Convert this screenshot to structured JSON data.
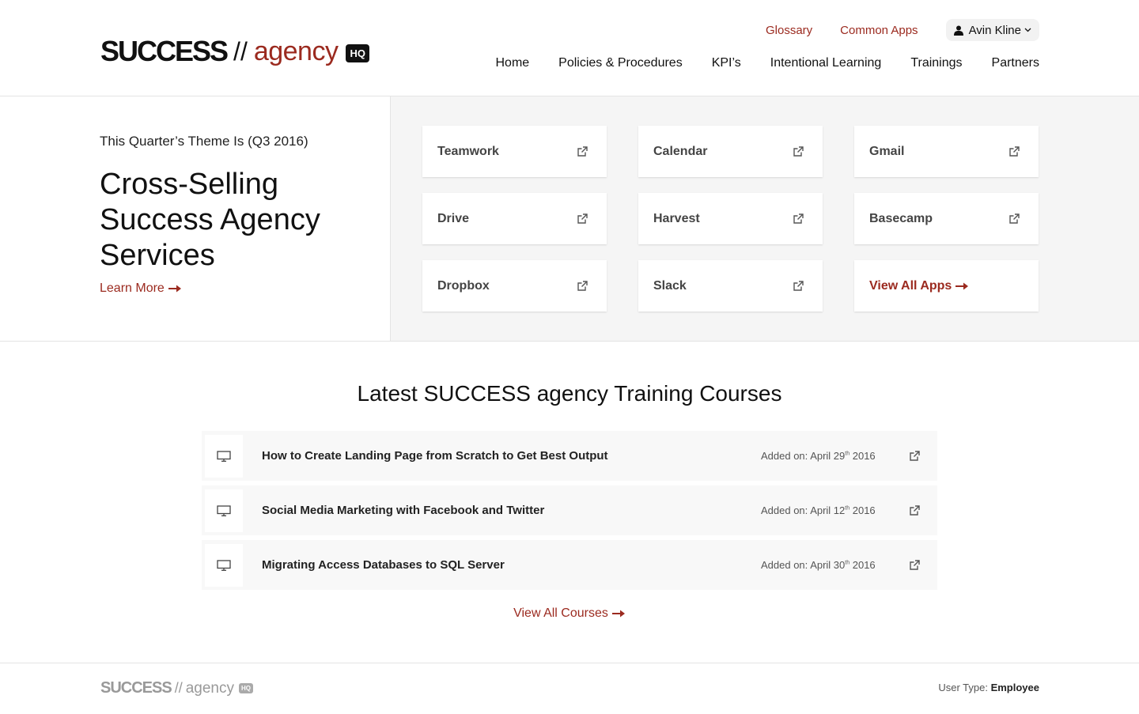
{
  "brand": {
    "success": "SUCCESS",
    "separator": "//",
    "agency": "agency",
    "hq": "HQ"
  },
  "top_links": [
    "Glossary",
    "Common Apps"
  ],
  "user": {
    "name": "Avin Kline"
  },
  "nav": [
    "Home",
    "Policies & Procedures",
    "KPI’s",
    "Intentional Learning",
    "Trainings",
    "Partners"
  ],
  "theme": {
    "label": "This Quarter’s Theme Is (Q3 2016)",
    "title_lines": [
      "Cross-Selling",
      "Success Agency",
      "Services"
    ],
    "learn_more": "Learn More"
  },
  "apps": [
    "Teamwork",
    "Calendar",
    "Gmail",
    "Drive",
    "Harvest",
    "Basecamp",
    "Dropbox",
    "Slack"
  ],
  "apps_view_all": "View All Apps",
  "courses": {
    "title": "Latest SUCCESS agency Training Courses",
    "date_prefix": "Added on:",
    "items": [
      {
        "title": "How to Create Landing Page from Scratch to Get Best Output",
        "date_month_day": "April 29",
        "date_suffix": "th",
        "date_year": "2016"
      },
      {
        "title": "Social Media Marketing with Facebook and Twitter",
        "date_month_day": "April 12",
        "date_suffix": "th",
        "date_year": "2016"
      },
      {
        "title": "Migrating Access Databases to SQL Server",
        "date_month_day": "April 30",
        "date_suffix": "th",
        "date_year": "2016"
      }
    ],
    "view_all": "View All Courses"
  },
  "footer": {
    "user_type_label": "User Type:",
    "user_type_value": "Employee"
  },
  "colors": {
    "accent": "#9b2a1f",
    "panel_bg": "#f5f5f5"
  },
  "icons": {
    "external": "external-link-icon",
    "course": "monitor-icon",
    "user": "user-icon",
    "arrow": "arrow-right-icon"
  }
}
